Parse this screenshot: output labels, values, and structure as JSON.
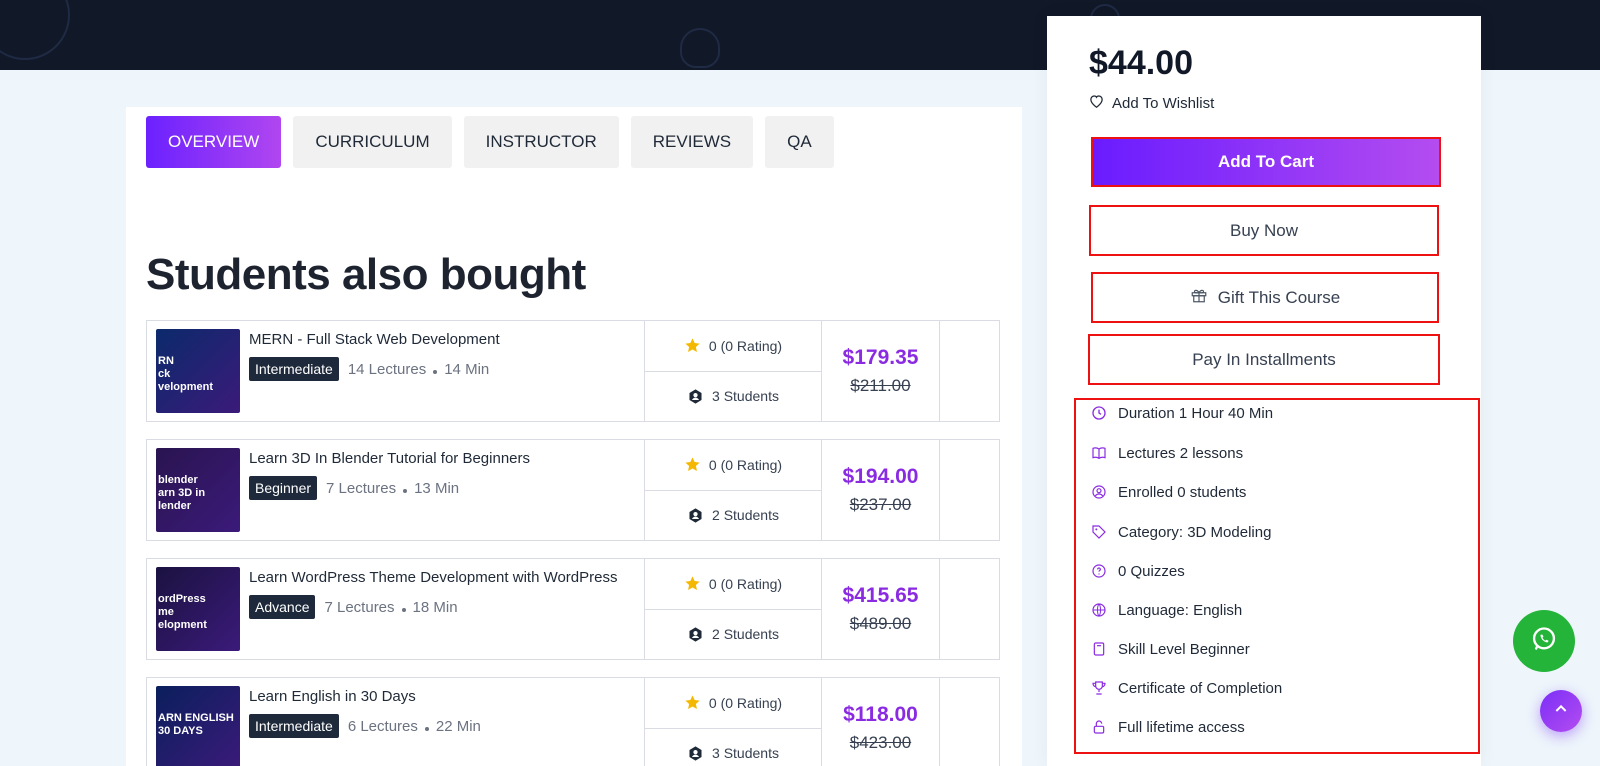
{
  "tabs": [
    {
      "label": "OVERVIEW"
    },
    {
      "label": "CURRICULUM"
    },
    {
      "label": "INSTRUCTOR"
    },
    {
      "label": "REVIEWS"
    },
    {
      "label": "QA"
    }
  ],
  "section_title": "Students also bought",
  "courses": [
    {
      "title": "MERN - Full Stack Web Development",
      "level": "Intermediate",
      "lectures": "14 Lectures",
      "duration": "14 Min",
      "rating": "0 (0 Rating)",
      "students": "3 Students",
      "price": "$179.35",
      "old_price": "$211.00",
      "thumb_text": "RN\nck\nvelopment",
      "thumb_color": "#0b2a6b"
    },
    {
      "title": "Learn 3D In Blender Tutorial for Beginners",
      "level": "Beginner",
      "lectures": "7 Lectures",
      "duration": "13 Min",
      "rating": "0 (0 Rating)",
      "students": "2 Students",
      "price": "$194.00",
      "old_price": "$237.00",
      "thumb_text": "blender\narn 3D in\nlender",
      "thumb_color": "#2a1450"
    },
    {
      "title": "Learn WordPress Theme Development with WordPress",
      "level": "Advance",
      "lectures": "7 Lectures",
      "duration": "18 Min",
      "rating": "0 (0 Rating)",
      "students": "2 Students",
      "price": "$415.65",
      "old_price": "$489.00",
      "thumb_text": "ordPress\nme\nelopment",
      "thumb_color": "#1b1240"
    },
    {
      "title": "Learn English in 30 Days",
      "level": "Intermediate",
      "lectures": "6 Lectures",
      "duration": "22 Min",
      "rating": "0 (0 Rating)",
      "students": "3 Students",
      "price": "$118.00",
      "old_price": "$423.00",
      "thumb_text": "ARN ENGLISH\n30 DAYS",
      "thumb_color": "#0a1f5c"
    }
  ],
  "sidebar": {
    "price": "$44.00",
    "wishlist_label": "Add To Wishlist",
    "add_to_cart": "Add To Cart",
    "buy_now": "Buy Now",
    "gift": "Gift This Course",
    "pay_installments": "Pay In Installments",
    "features": [
      {
        "icon": "clock-icon",
        "text": "Duration 1 Hour 40 Min"
      },
      {
        "icon": "book-icon",
        "text": "Lectures 2 lessons"
      },
      {
        "icon": "user-circle-icon",
        "text": "Enrolled 0 students"
      },
      {
        "icon": "tag-icon",
        "text": "Category: 3D Modeling"
      },
      {
        "icon": "quiz-icon",
        "text": "0 Quizzes"
      },
      {
        "icon": "globe-icon",
        "text": "Language: English"
      },
      {
        "icon": "level-icon",
        "text": "Skill Level Beginner"
      },
      {
        "icon": "trophy-icon",
        "text": "Certificate of Completion"
      },
      {
        "icon": "lock-open-icon",
        "text": "Full lifetime access"
      }
    ]
  },
  "colors": {
    "accent": "#8a2be2",
    "highlight_border": "#ee1111",
    "header_bg": "#111827",
    "whatsapp": "#25b43a"
  }
}
